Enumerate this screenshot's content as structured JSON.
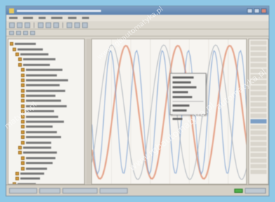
{
  "watermark": {
    "text": "www.rgbautomatyka.pl",
    "short": "matyka.pl",
    "short2": "automatyka.pl"
  },
  "colors": {
    "background": "#8fc8e6",
    "wave_red": "#e08a6a",
    "wave_blue": "#7b9fd0",
    "wave_gray": "#9aa3ad",
    "status_indicator": "#4fb04a"
  },
  "icons": {
    "toolbar": [
      "app-icon",
      "open-icon",
      "save-icon",
      "print-icon",
      "cut-icon",
      "copy-icon",
      "paste-icon",
      "zoom-icon",
      "chart-icon",
      "settings-icon"
    ],
    "status": [
      "status-ok-icon"
    ]
  }
}
